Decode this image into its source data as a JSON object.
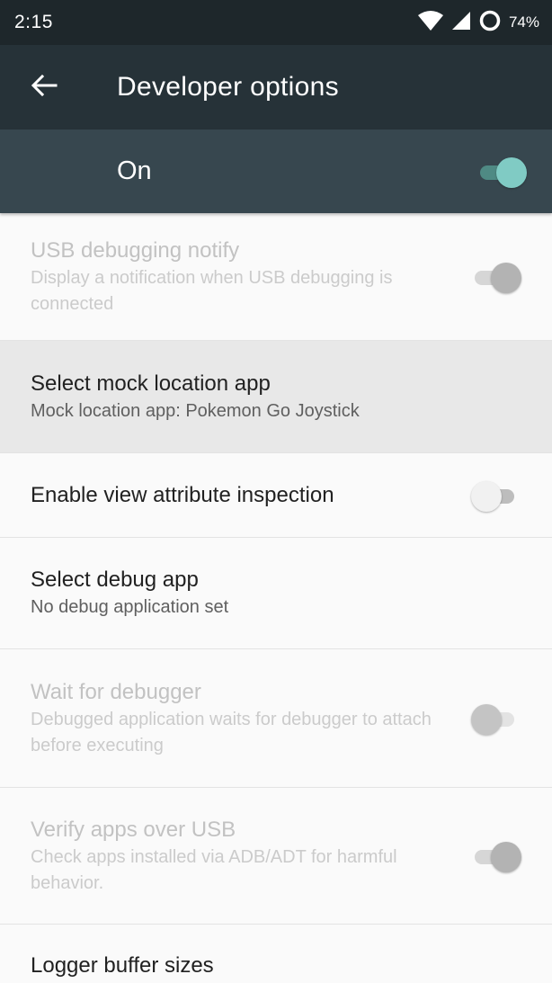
{
  "status_bar": {
    "time": "2:15",
    "battery_percent": "74%",
    "icons": [
      "wifi-icon",
      "cell-signal-icon",
      "battery-circle-icon"
    ]
  },
  "app_bar": {
    "title": "Developer options",
    "back_icon": "arrow-left-icon"
  },
  "master_switch": {
    "label": "On",
    "state": "on"
  },
  "settings": [
    {
      "title": "USB debugging notify",
      "summary": "Display a notification when USB debugging is connected",
      "enabled": false,
      "toggle": "on"
    },
    {
      "title": "Select mock location app",
      "summary": "Mock location app: Pokemon Go Joystick",
      "enabled": true,
      "selected": true
    },
    {
      "title": "Enable view attribute inspection",
      "enabled": true,
      "toggle": "off"
    },
    {
      "title": "Select debug app",
      "summary": "No debug application set",
      "enabled": true
    },
    {
      "title": "Wait for debugger",
      "summary": "Debugged application waits for debugger to attach before executing",
      "enabled": false,
      "toggle": "off"
    },
    {
      "title": "Verify apps over USB",
      "summary": "Check apps installed via ADB/ADT for harmful behavior.",
      "enabled": false,
      "toggle": "on"
    },
    {
      "title": "Logger buffer sizes",
      "enabled": true
    }
  ],
  "colors": {
    "status_bar": "#1e272b",
    "app_bar": "#263238",
    "master_bar": "#37474f",
    "accent": "#80cbc4",
    "accent_track": "#4f8a84",
    "disabled_thumb": "#b3b3b3",
    "disabled_track": "#d6d6d6",
    "off_thumb": "#f1f1f1",
    "off_track": "#bdbdbd"
  }
}
